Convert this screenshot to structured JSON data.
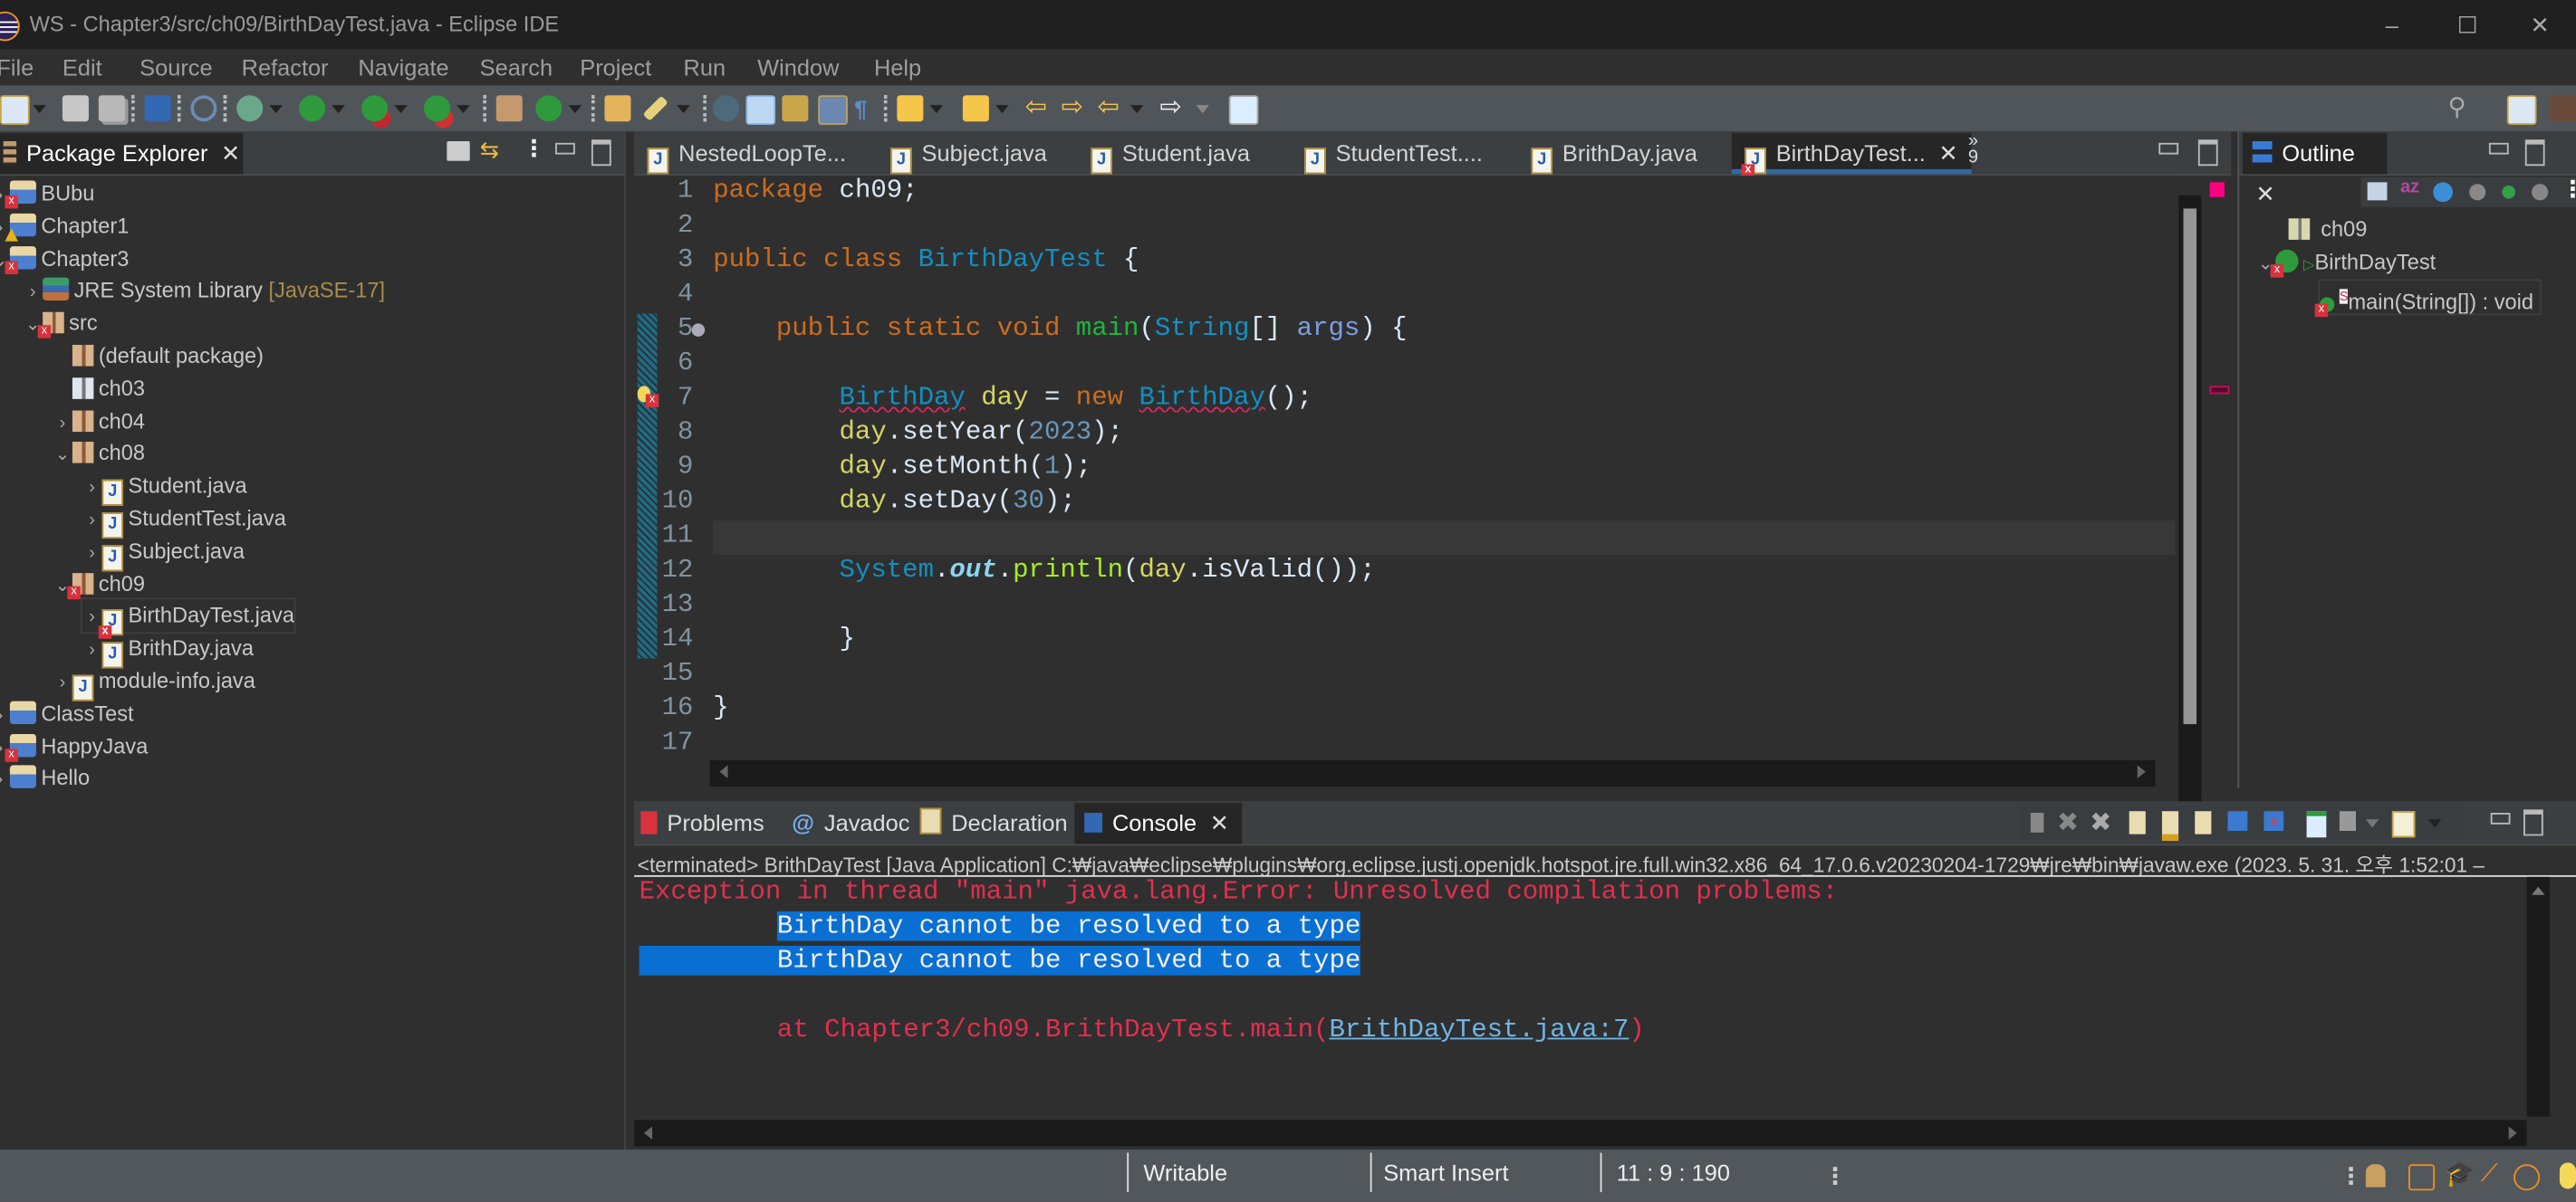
{
  "window": {
    "title": "WS - Chapter3/src/ch09/BirthDayTest.java - Eclipse IDE",
    "controls": {
      "minimize": "–",
      "maximize": "☐",
      "close": "✕"
    }
  },
  "menu": [
    "File",
    "Edit",
    "Source",
    "Refactor",
    "Navigate",
    "Search",
    "Project",
    "Run",
    "Window",
    "Help"
  ],
  "toolbar": {
    "icons": [
      "new-icon",
      "save-icon",
      "save-all-icon",
      "terminal-icon",
      "skip-breakpoints-icon",
      "debug-icon",
      "run-icon",
      "coverage-icon",
      "external-tools-icon",
      "new-package-icon",
      "new-class-icon",
      "open-type-icon",
      "search-icon",
      "open-task-icon",
      "toggle-highlight-icon",
      "word-wrap-icon",
      "block-selection-icon",
      "show-whitespace-icon",
      "next-annotation-icon",
      "prev-annotation-icon",
      "last-edit-icon",
      "forward-edit-icon",
      "back-icon",
      "forward-icon",
      "pin-editor-icon"
    ],
    "right_icons": [
      "search-icon",
      "open-perspective-icon",
      "java-perspective-icon"
    ]
  },
  "package_explorer": {
    "title": "Package Explorer",
    "tree": [
      {
        "label": "BUbu",
        "level": 0,
        "expanded": false,
        "icon": "project",
        "badge": "error"
      },
      {
        "label": "Chapter1",
        "level": 0,
        "expanded": false,
        "icon": "project",
        "badge": "warning"
      },
      {
        "label": "Chapter3",
        "level": 0,
        "expanded": true,
        "icon": "project",
        "badge": "error"
      },
      {
        "label": "JRE System Library",
        "decoration": "[JavaSE-17]",
        "level": 1,
        "expanded": false,
        "icon": "library"
      },
      {
        "label": "src",
        "level": 1,
        "expanded": true,
        "icon": "source-folder",
        "badge": "error"
      },
      {
        "label": "(default package)",
        "level": 2,
        "icon": "package"
      },
      {
        "label": "ch03",
        "level": 2,
        "icon": "empty-package"
      },
      {
        "label": "ch04",
        "level": 2,
        "expanded": false,
        "icon": "package"
      },
      {
        "label": "ch08",
        "level": 2,
        "expanded": true,
        "icon": "package"
      },
      {
        "label": "Student.java",
        "level": 3,
        "expanded": false,
        "icon": "java-file"
      },
      {
        "label": "StudentTest.java",
        "level": 3,
        "expanded": false,
        "icon": "java-file"
      },
      {
        "label": "Subject.java",
        "level": 3,
        "expanded": false,
        "icon": "java-file"
      },
      {
        "label": "ch09",
        "level": 2,
        "expanded": true,
        "icon": "package",
        "badge": "error"
      },
      {
        "label": "BirthDayTest.java",
        "level": 3,
        "expanded": false,
        "icon": "java-file",
        "badge": "error",
        "selected": true
      },
      {
        "label": "BrithDay.java",
        "level": 3,
        "expanded": false,
        "icon": "java-file"
      },
      {
        "label": "module-info.java",
        "level": 2,
        "expanded": false,
        "icon": "java-file"
      },
      {
        "label": "ClassTest",
        "level": 0,
        "expanded": false,
        "icon": "project"
      },
      {
        "label": "HappyJava",
        "level": 0,
        "expanded": false,
        "icon": "project",
        "badge": "error"
      },
      {
        "label": "Hello",
        "level": 0,
        "expanded": false,
        "icon": "project"
      }
    ]
  },
  "editor": {
    "tabs": [
      {
        "label": "NestedLoopTe..."
      },
      {
        "label": "Subject.java"
      },
      {
        "label": "Student.java"
      },
      {
        "label": "StudentTest...."
      },
      {
        "label": "BrithDay.java"
      },
      {
        "label": "BirthDayTest...",
        "active": true,
        "error": true
      }
    ],
    "overflow_count": "9",
    "overflow_glyph": "»",
    "lines": [
      "1",
      "2",
      "3",
      "4",
      "5",
      "6",
      "7",
      "8",
      "9",
      "10",
      "11",
      "12",
      "13",
      "14",
      "15",
      "16",
      "17"
    ],
    "code": {
      "l1": {
        "kw": "package",
        "rest": " ch09;"
      },
      "l3": {
        "kw1": "public",
        "kw2": "class",
        "type": "BirthDayTest",
        "rest": " {"
      },
      "l5": {
        "kw1": "public",
        "kw2": "static",
        "kw3": "void",
        "method": "main",
        "type": "String",
        "param": "args",
        "rest": ") {"
      },
      "l7": {
        "type1": "BirthDay",
        "var": "day",
        "eq": " = ",
        "kw": "new",
        "type2": "BirthDay",
        "rest": "();"
      },
      "l8": {
        "var": "day",
        "call": ".setYear(",
        "num": "2023",
        "rest": ");"
      },
      "l9": {
        "var": "day",
        "call": ".setMonth(",
        "num": "1",
        "rest": ");"
      },
      "l10": {
        "var": "day",
        "call": ".setDay(",
        "num": "30",
        "rest": ");"
      },
      "l12": {
        "type": "System",
        "field": "out",
        "method": "println",
        "var": "day",
        "rest": ".isValid());"
      },
      "l14": "}",
      "l16": "}"
    },
    "current_line": "11",
    "error_line": "7"
  },
  "outline": {
    "title": "Outline",
    "items": [
      {
        "label": "ch09",
        "icon": "package"
      },
      {
        "label": "BirthDayTest",
        "icon": "class",
        "badge": "error",
        "expanded": true
      },
      {
        "label": "main(String[]) : void",
        "icon": "method",
        "badge": "error",
        "static": true
      }
    ]
  },
  "console": {
    "tabs": [
      {
        "label": "Problems",
        "icon": "problems-icon"
      },
      {
        "label": "Javadoc",
        "icon": "at-icon"
      },
      {
        "label": "Declaration",
        "icon": "declaration-icon"
      },
      {
        "label": "Console",
        "icon": "console-icon",
        "active": true
      }
    ],
    "header": "<terminated> BrithDayTest [Java Application] C:₩java₩eclipse₩plugins₩org.eclipse.justj.openjdk.hotspot.jre.full.win32.x86_64_17.0.6.v20230204-1729₩jre₩bin₩javaw.exe  (2023. 5. 31. 오후 1:52:01 –",
    "lines": {
      "exception": "Exception in thread \"main\" java.lang.Error: Unresolved compilation problems: ",
      "err1": "BirthDay cannot be resolved to a type",
      "err2": "BirthDay cannot be resolved to a type",
      "at_prefix": "\tat Chapter3/ch09.BrithDayTest.main(",
      "at_link": "BrithDayTest.java:7",
      "at_suffix": ")"
    }
  },
  "status_bar": {
    "writable": "Writable",
    "insert_mode": "Smart Insert",
    "position": "11 : 9 : 190"
  },
  "colors": {
    "error_red": "#e0304e",
    "selection_blue": "#0a6fd2",
    "keyword": "#cc6c1d",
    "type": "#1290c3",
    "overview_error": "#ff0080"
  }
}
